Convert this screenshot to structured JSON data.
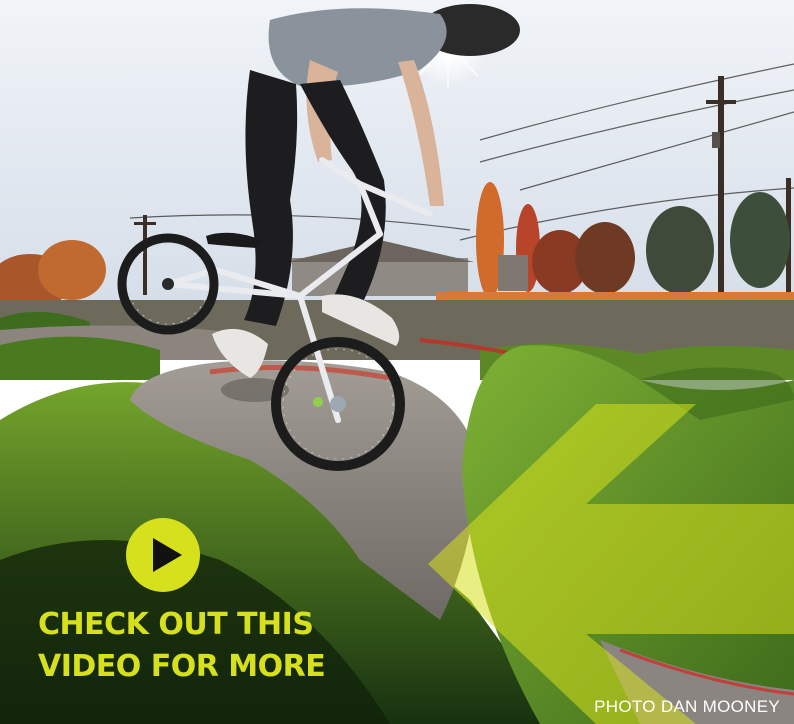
{
  "colors": {
    "accent": "#d7e01c",
    "sky_top": "#e9eef5",
    "sky_bottom": "#cfd9e6",
    "turf": "#5f8f24",
    "turf_dark": "#1e3a0f",
    "track": "#8f8a84",
    "autumn": "#d2682a",
    "credit_text": "#ffffff"
  },
  "icons": {
    "play": "play-circle-icon"
  },
  "cta": {
    "line1": "CHECK OUT THIS",
    "line2": "VIDEO FOR MORE"
  },
  "credit": "PHOTO DAN MOONEY"
}
